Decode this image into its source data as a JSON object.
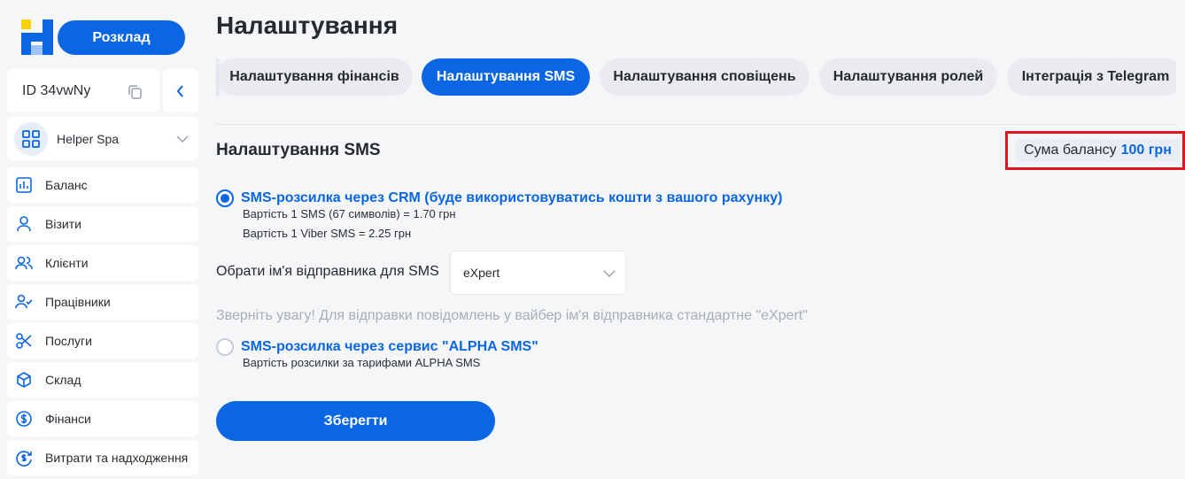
{
  "sidebar": {
    "schedule_label": "Розклад",
    "account_id": "ID 34vwNy",
    "company_name": "Helper Spa",
    "items": [
      {
        "label": "Баланс",
        "icon": "chart-bar-icon"
      },
      {
        "label": "Візити",
        "icon": "user-icon"
      },
      {
        "label": "Клієнти",
        "icon": "users-icon"
      },
      {
        "label": "Працівники",
        "icon": "user-check-icon"
      },
      {
        "label": "Послуги",
        "icon": "scissors-icon"
      },
      {
        "label": "Склад",
        "icon": "box-icon"
      },
      {
        "label": "Фінанси",
        "icon": "dollar-circle-icon"
      },
      {
        "label": "Витрати та надходження",
        "icon": "dollar-refresh-icon"
      }
    ]
  },
  "header": {
    "title": "Налаштування"
  },
  "tabs": [
    {
      "label": "Налаштування фінансів",
      "active": false
    },
    {
      "label": "Налаштування SMS",
      "active": true
    },
    {
      "label": "Налаштування сповіщень",
      "active": false
    },
    {
      "label": "Налаштування ролей",
      "active": false
    },
    {
      "label": "Інтеграція з Telegram",
      "active": false
    }
  ],
  "sms": {
    "section_title": "Налаштування SMS",
    "balance_label": "Сума балансу",
    "balance_value": "100 грн",
    "option_crm": {
      "title": "SMS-розсилка через CRM (буде використовуватись кошти з вашого рахунку)",
      "cost_sms": "Вартість 1 SMS (67 символів) = 1.70 грн",
      "cost_viber": "Вартість 1 Viber SMS = 2.25 грн",
      "selected": true
    },
    "sender_label": "Обрати ім'я відправника для SMS",
    "sender_value": "eXpert",
    "notice": "Зверніть увагу! Для відправки повідомлень у вайбер ім'я відправника стандартне \"eXpert\"",
    "option_alpha": {
      "title": "SMS-розсилка через сервис \"ALPHA SMS\"",
      "cost": "Вартість розсилки за тарифами ALPHA SMS",
      "selected": false
    },
    "save_label": "Зберегти"
  },
  "colors": {
    "accent": "#0b66e4",
    "highlight_border": "#e0161c",
    "logo_yellow": "#f5d20b"
  }
}
